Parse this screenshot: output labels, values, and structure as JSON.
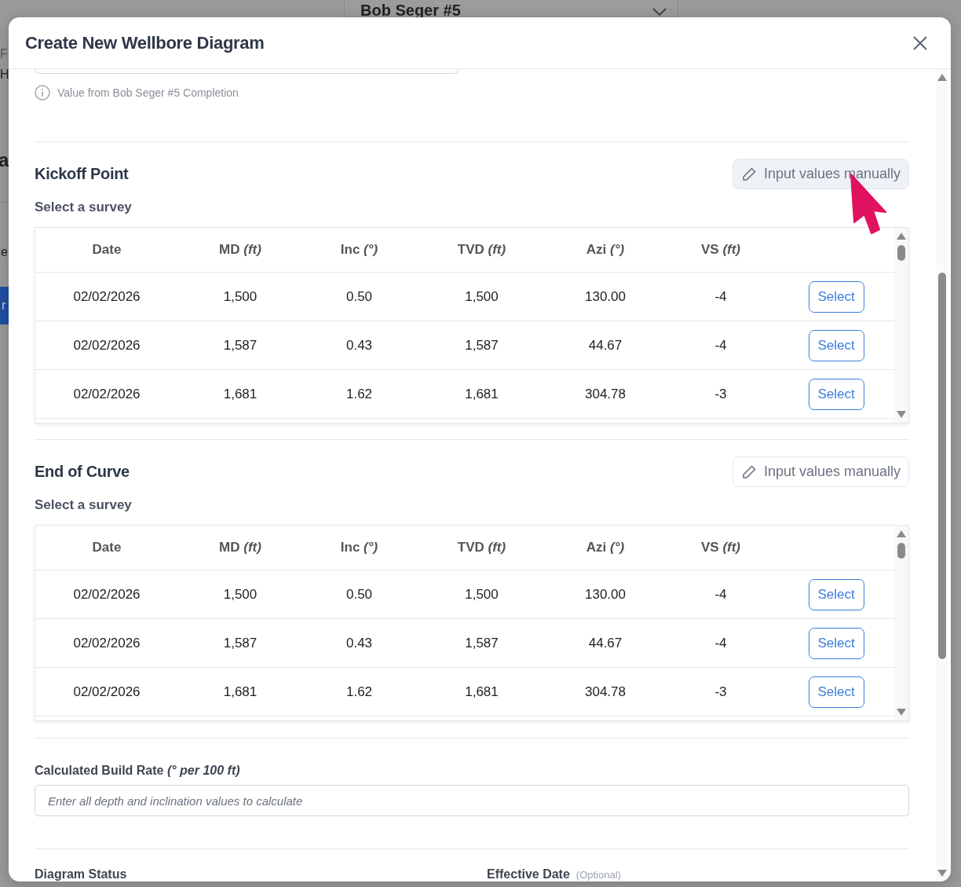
{
  "background": {
    "dropdown_value": "Bob Seger #5",
    "fragments": [
      "F",
      "H",
      "a",
      "e"
    ],
    "button_fragment": "r"
  },
  "dialog": {
    "title": "Create New Wellbore Diagram"
  },
  "source_note": "Value from Bob Seger #5 Completion",
  "sections": [
    {
      "title": "Kickoff Point",
      "manual_button": {
        "label": "Input values manually",
        "hovered": true
      },
      "subtitle": "Select a survey",
      "columns": [
        "Date",
        "MD *(ft)*",
        "Inc *(°)*",
        "TVD *(ft)*",
        "Azi *(°)*",
        "VS *(ft)*"
      ],
      "rows": [
        {
          "date": "02/02/2026",
          "md": "1,500",
          "inc": "0.50",
          "tvd": "1,500",
          "azi": "130.00",
          "vs": "-4",
          "action": "Select"
        },
        {
          "date": "02/02/2026",
          "md": "1,587",
          "inc": "0.43",
          "tvd": "1,587",
          "azi": "44.67",
          "vs": "-4",
          "action": "Select"
        },
        {
          "date": "02/02/2026",
          "md": "1,681",
          "inc": "1.62",
          "tvd": "1,681",
          "azi": "304.78",
          "vs": "-3",
          "action": "Select"
        }
      ]
    },
    {
      "title": "End of Curve",
      "manual_button": {
        "label": "Input values manually",
        "hovered": false
      },
      "subtitle": "Select a survey",
      "columns": [
        "Date",
        "MD *(ft)*",
        "Inc *(°)*",
        "TVD *(ft)*",
        "Azi *(°)*",
        "VS *(ft)*"
      ],
      "rows": [
        {
          "date": "02/02/2026",
          "md": "1,500",
          "inc": "0.50",
          "tvd": "1,500",
          "azi": "130.00",
          "vs": "-4",
          "action": "Select"
        },
        {
          "date": "02/02/2026",
          "md": "1,587",
          "inc": "0.43",
          "tvd": "1,587",
          "azi": "44.67",
          "vs": "-4",
          "action": "Select"
        },
        {
          "date": "02/02/2026",
          "md": "1,681",
          "inc": "1.62",
          "tvd": "1,681",
          "azi": "304.78",
          "vs": "-3",
          "action": "Select"
        }
      ]
    }
  ],
  "build_rate": {
    "label": "Calculated Build Rate *(° per 100 ft)*",
    "placeholder": "Enter all depth and inclination values to calculate"
  },
  "footer_fields": [
    {
      "label": "Diagram Status"
    },
    {
      "label": "Effective Date",
      "hint": "(Optional)"
    }
  ]
}
